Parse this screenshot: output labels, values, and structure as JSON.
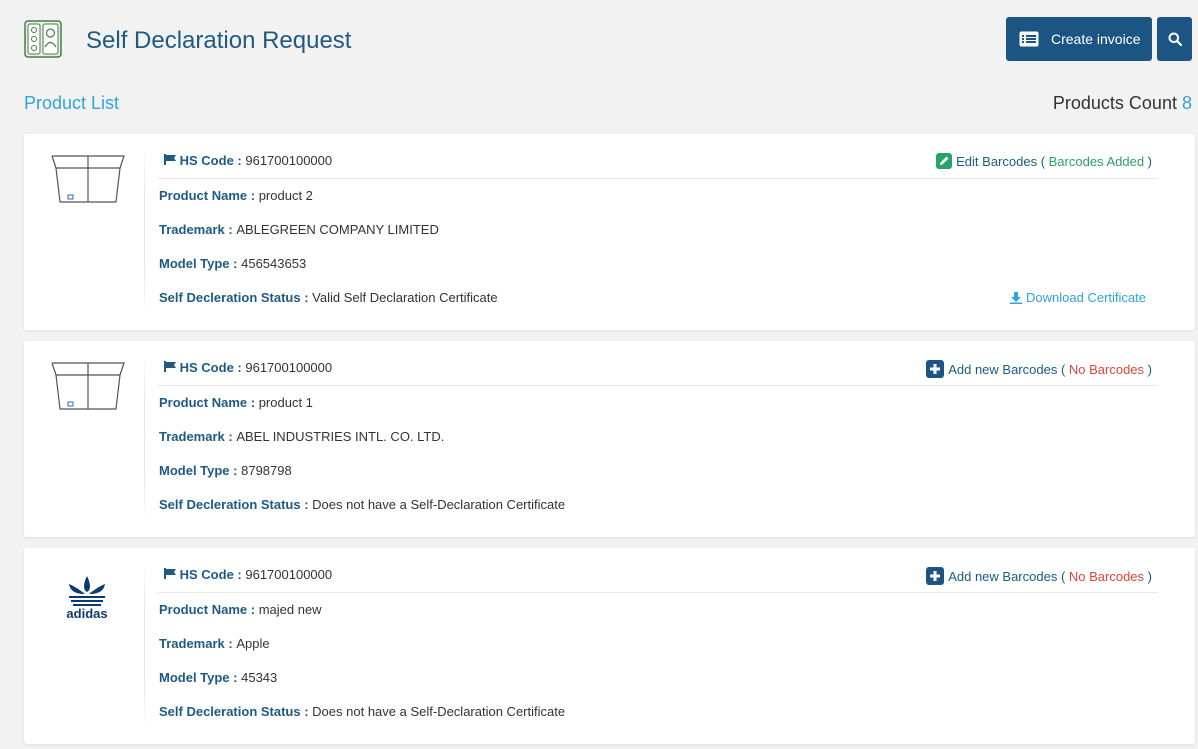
{
  "header": {
    "title": "Self Declaration Request",
    "create_invoice_label": "Create invoice"
  },
  "list": {
    "title": "Product List",
    "count_label": "Products Count",
    "count_value": "8"
  },
  "labels": {
    "hs_code": "HS Code",
    "product_name": "Product Name",
    "trademark": "Trademark",
    "model_type": "Model Type",
    "status": "Self Decleration Status",
    "download": "Download Certificate"
  },
  "products": [
    {
      "image": "empty-box-icon",
      "hs_code": "961700100000",
      "barcode_action": "Edit Barcodes",
      "barcode_status": "Barcodes Added",
      "name": "product 2",
      "trademark": "ABLEGREEN COMPANY LIMITED",
      "model_type": "456543653",
      "status": "Valid Self Declaration Certificate"
    },
    {
      "image": "empty-box-icon",
      "hs_code": "961700100000",
      "barcode_action": "Add new Barcodes",
      "barcode_status": "No Barcodes",
      "name": "product 1",
      "trademark": "ABEL INDUSTRIES INTL. CO. LTD.",
      "model_type": "8798798",
      "status": "Does not have a Self-Declaration Certificate"
    },
    {
      "image": "adidas-logo",
      "image_text": "adidas",
      "hs_code": "961700100000",
      "barcode_action": "Add new Barcodes",
      "barcode_status": "No Barcodes",
      "name": "majed new",
      "trademark": "Apple",
      "model_type": "45343",
      "status": "Does not have a Self-Declaration Certificate"
    }
  ],
  "colors": {
    "primary": "#1c5584",
    "accent": "#2fa4dc",
    "success": "#29a36a",
    "danger": "#e0453b"
  }
}
